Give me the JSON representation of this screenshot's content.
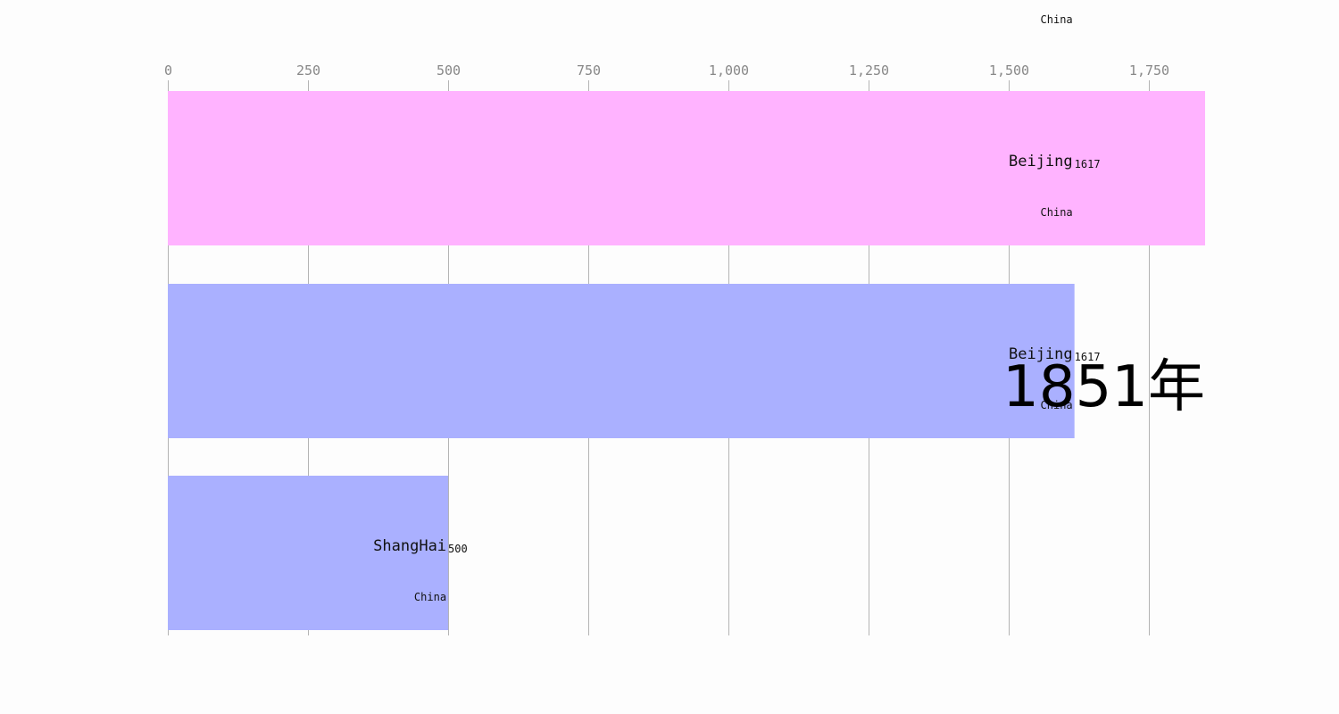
{
  "chart_data": {
    "type": "bar",
    "orientation": "horizontal",
    "title": "",
    "xlabel": "",
    "ylabel": "",
    "xlim": [
      0,
      1850
    ],
    "x_ticks": [
      0,
      250,
      500,
      750,
      1000,
      1250,
      1500,
      1750
    ],
    "x_tick_labels": [
      "0",
      "250",
      "500",
      "750",
      "1,000",
      "1,250",
      "1,500",
      "1,750"
    ],
    "grid": true,
    "year": "1851年",
    "bars": [
      {
        "name": "Beijing",
        "value": 1850,
        "value_label": "1617",
        "group": "China",
        "color": "#ffb3ff"
      },
      {
        "name": "Beijing",
        "value": 1617,
        "value_label": "1617",
        "group": "China",
        "color": "#aab0ff"
      },
      {
        "name": "ShangHai",
        "value": 500,
        "value_label": "500",
        "group": "China",
        "color": "#aab0ff"
      }
    ],
    "stray_labels": [
      {
        "text": "China",
        "value": 1617
      }
    ]
  }
}
